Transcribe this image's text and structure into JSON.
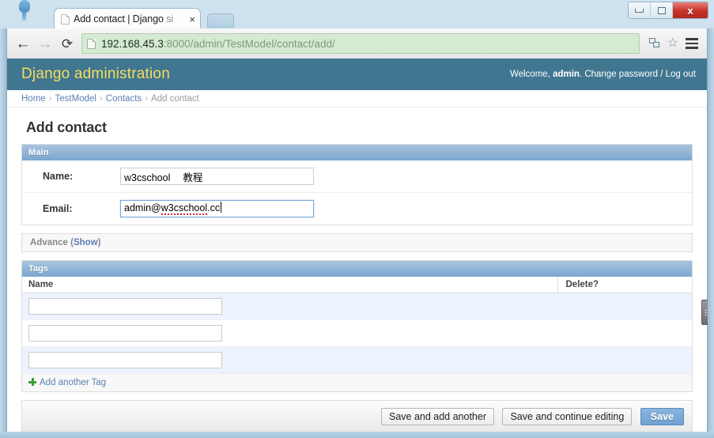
{
  "window": {
    "minimize_label": "Minimize",
    "maximize_label": "Maximize",
    "close_label": "x"
  },
  "browser": {
    "tab": {
      "title_main": "Add contact | Django ",
      "title_faded": "si",
      "close_label": "×"
    },
    "nav": {
      "back": "←",
      "forward": "→",
      "reload": "⟳"
    },
    "omnibox": {
      "host": "192.168.45.3",
      "path": ":8000/admin/TestModel/contact/add/",
      "star": "☆"
    }
  },
  "django": {
    "branding": "Django administration",
    "usertools": {
      "welcome_prefix": "Welcome, ",
      "username": "admin",
      "separator": ". ",
      "change_password": "Change password",
      "divider": " / ",
      "logout": "Log out"
    },
    "breadcrumbs": [
      {
        "label": "Home",
        "link": true
      },
      {
        "label": "TestModel",
        "link": true
      },
      {
        "label": "Contacts",
        "link": true
      },
      {
        "label": "Add contact",
        "link": false
      }
    ],
    "page_title": "Add contact",
    "main_fieldset": {
      "legend": "Main",
      "rows": [
        {
          "label": "Name:",
          "value": "w3cschool 　教程"
        },
        {
          "label": "Email:",
          "value": "admin@w3cschool.cc"
        }
      ]
    },
    "email_parts": {
      "prefix": "admin@",
      "misspelled": "w3cschool",
      "suffix": ".cc"
    },
    "advance_fieldset": {
      "legend": "Advance",
      "toggle_open": "(",
      "toggle_label": "Show",
      "toggle_close": ")"
    },
    "tags_inline": {
      "legend": "Tags",
      "columns": [
        "Name",
        "Delete?"
      ],
      "rows": [
        {
          "name": ""
        },
        {
          "name": ""
        },
        {
          "name": ""
        }
      ],
      "add_another": "Add another Tag"
    },
    "submit_row": {
      "save_and_add_another": "Save and add another",
      "save_and_continue": "Save and continue editing",
      "save": "Save"
    },
    "colors": {
      "header_bg": "#417690",
      "branding_text": "#f5dd5d",
      "link": "#5b80b2",
      "module_header": "#7ba7cf",
      "row_alt_bg": "#edf3fe",
      "default_button": "#6ea2d3",
      "omnibox_bg": "#d5ead2"
    }
  }
}
